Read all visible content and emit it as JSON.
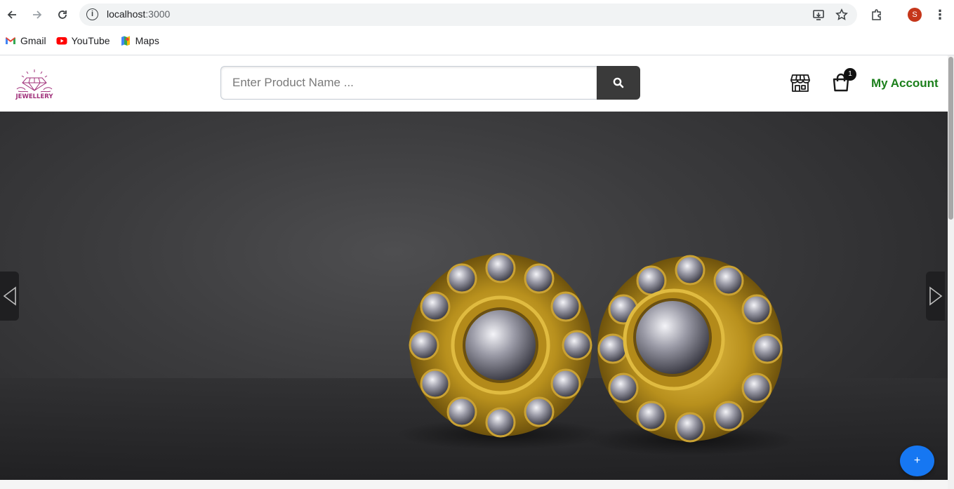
{
  "browser": {
    "url_host": "localhost",
    "url_port": ":3000",
    "profile_initial": "S",
    "bookmarks": [
      {
        "label": "Gmail",
        "icon": "gmail-icon"
      },
      {
        "label": "YouTube",
        "icon": "youtube-icon"
      },
      {
        "label": "Maps",
        "icon": "maps-icon"
      }
    ]
  },
  "header": {
    "logo_text": "JEWELLERY",
    "search": {
      "placeholder": "Enter Product Name ...",
      "value": ""
    },
    "cart_count": "1",
    "account_label": "My Account"
  },
  "hero": {
    "prev_icon": "triangle-left-icon",
    "next_icon": "triangle-right-icon",
    "image": "diamond-gold-earrings"
  },
  "fab": {
    "label": "+"
  },
  "colors": {
    "search_button": "#3a3a3a",
    "account_link": "#1b7f1b",
    "fab": "#1677f2",
    "logo": "#a0307a"
  }
}
